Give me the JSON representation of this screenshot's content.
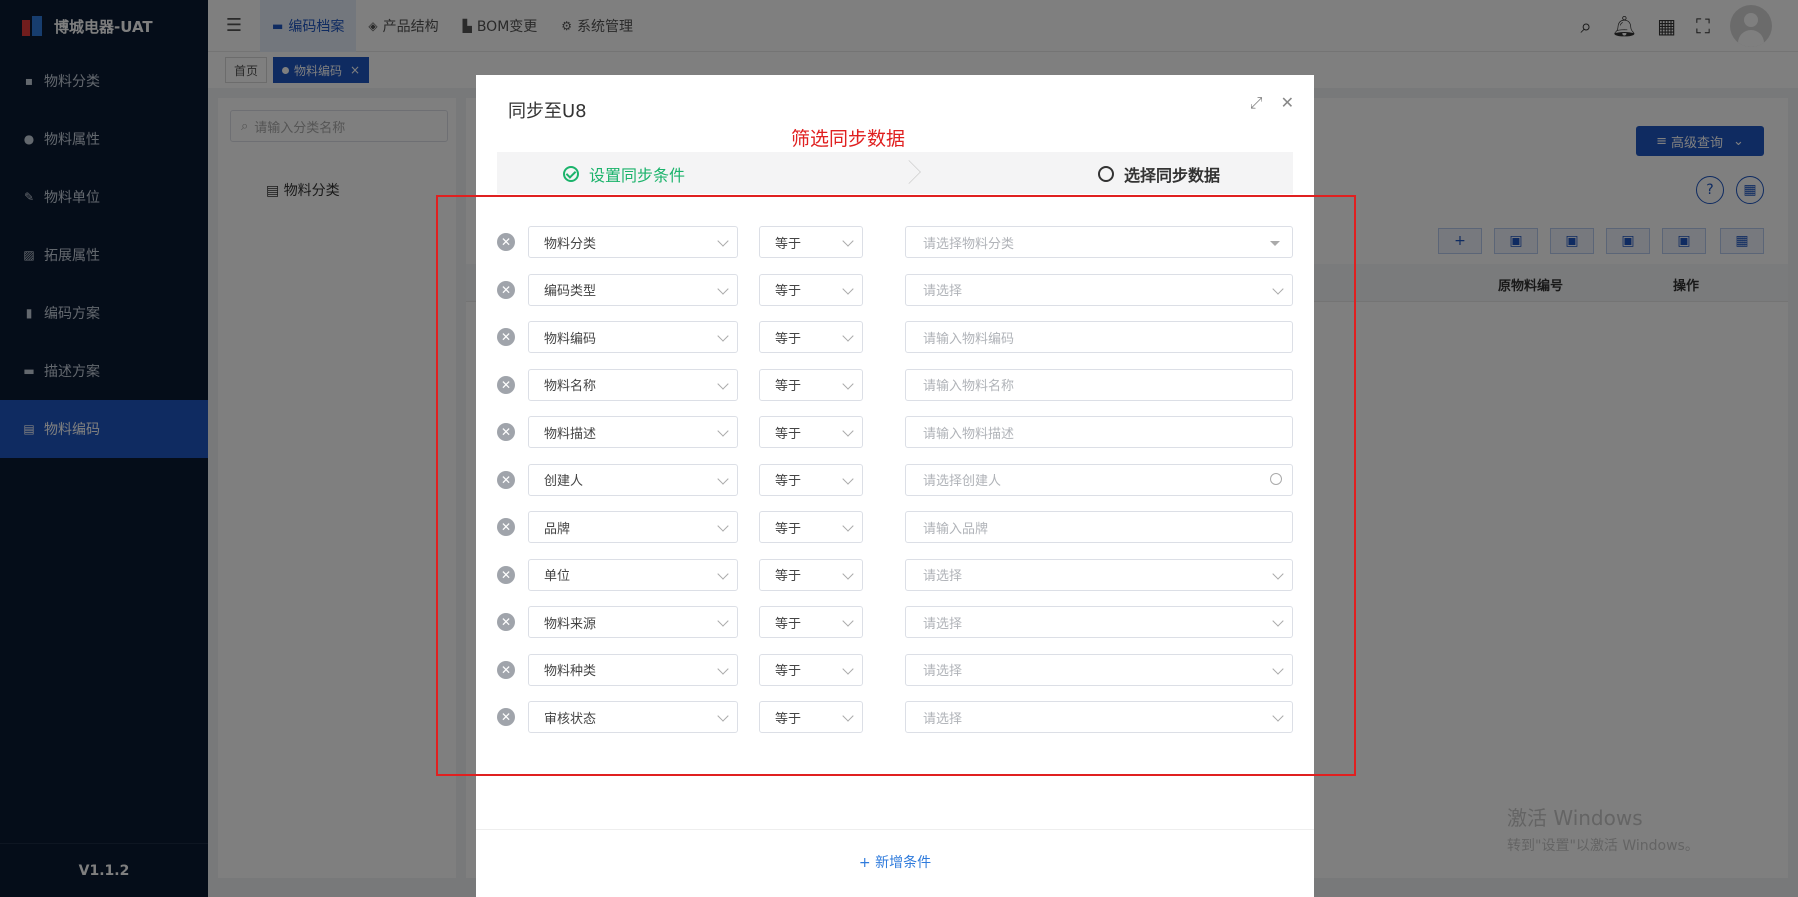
{
  "app": {
    "title": "博城电器-UAT",
    "version": "V1.1.2"
  },
  "sidebar": {
    "items": [
      {
        "label": "物料分类",
        "icon": "grid-icon",
        "active": false
      },
      {
        "label": "物料属性",
        "icon": "info-icon",
        "active": false
      },
      {
        "label": "物料单位",
        "icon": "pen-icon",
        "active": false
      },
      {
        "label": "拓展属性",
        "icon": "image-icon",
        "active": false
      },
      {
        "label": "编码方案",
        "icon": "file-icon",
        "active": false
      },
      {
        "label": "描述方案",
        "icon": "monitor-icon",
        "active": false
      },
      {
        "label": "物料编码",
        "icon": "doc-icon",
        "active": true
      }
    ]
  },
  "header": {
    "nav": [
      {
        "label": "编码档案",
        "icon": "folder-icon",
        "active": true
      },
      {
        "label": "产品结构",
        "icon": "layers-icon",
        "active": false
      },
      {
        "label": "BOM变更",
        "icon": "chart-icon",
        "active": false
      },
      {
        "label": "系统管理",
        "icon": "gear-icon",
        "active": false
      }
    ]
  },
  "tags": {
    "home": "首页",
    "current": "物料编码"
  },
  "left_panel": {
    "search_placeholder": "请输入分类名称",
    "tree_root": "物料分类"
  },
  "right_panel": {
    "advanced_query": "高级查询",
    "columns": {
      "original_code": "原物料编号",
      "actions": "操作"
    }
  },
  "watermark": {
    "line1": "激活 Windows",
    "line2": "转到\"设置\"以激活 Windows。"
  },
  "modal": {
    "title": "同步至U8",
    "annotation": "筛选同步数据",
    "steps": {
      "step1": "设置同步条件",
      "step2": "选择同步数据"
    },
    "add_condition": "+ 新增条件",
    "conditions": [
      {
        "field": "物料分类",
        "op": "等于",
        "placeholder": "请选择物料分类",
        "kind": "tree"
      },
      {
        "field": "编码类型",
        "op": "等于",
        "placeholder": "请选择",
        "kind": "select"
      },
      {
        "field": "物料编码",
        "op": "等于",
        "placeholder": "请输入物料编码",
        "kind": "input"
      },
      {
        "field": "物料名称",
        "op": "等于",
        "placeholder": "请输入物料名称",
        "kind": "input"
      },
      {
        "field": "物料描述",
        "op": "等于",
        "placeholder": "请输入物料描述",
        "kind": "input"
      },
      {
        "field": "创建人",
        "op": "等于",
        "placeholder": "请选择创建人",
        "kind": "lookup"
      },
      {
        "field": "品牌",
        "op": "等于",
        "placeholder": "请输入品牌",
        "kind": "input"
      },
      {
        "field": "单位",
        "op": "等于",
        "placeholder": "请选择",
        "kind": "select"
      },
      {
        "field": "物料来源",
        "op": "等于",
        "placeholder": "请选择",
        "kind": "select"
      },
      {
        "field": "物料种类",
        "op": "等于",
        "placeholder": "请选择",
        "kind": "select"
      },
      {
        "field": "审核状态",
        "op": "等于",
        "placeholder": "请选择",
        "kind": "select"
      }
    ]
  },
  "colors": {
    "primary": "#1f57c3",
    "sidebar_bg": "#0b1a33",
    "success": "#1bb36b",
    "annotation": "#e02020"
  }
}
